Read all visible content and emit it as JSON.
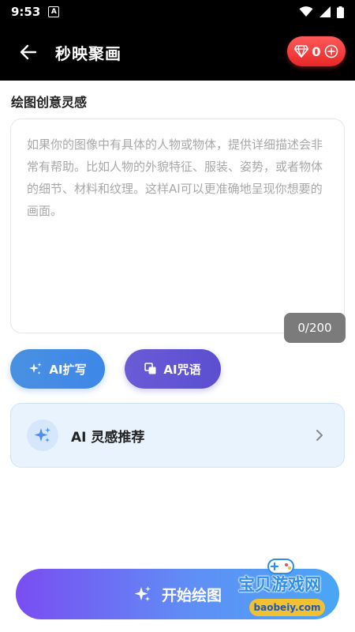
{
  "status_bar": {
    "time": "9:53",
    "notification_glyph": "A"
  },
  "header": {
    "title": "秒映聚画",
    "gem_count": "0"
  },
  "prompt": {
    "section_label": "绘图创意灵感",
    "placeholder": "如果你的图像中有具体的人物或物体，提供详细描述会非常有帮助。比如人物的外貌特征、服装、姿势，或者物体的细节、材料和纹理。这样AI可以更准确地呈现你想要的画面。",
    "value": "",
    "counter": "0/200"
  },
  "actions": {
    "expand_label": "AI扩写",
    "spell_label": "AI咒语"
  },
  "inspiration": {
    "label": "AI 灵感推荐"
  },
  "start_button": {
    "label": "开始绘图"
  },
  "watermark": {
    "brand": "宝贝游戏网",
    "domain": "baobeiy.com"
  },
  "colors": {
    "header_bg": "#000000",
    "gem_badge": "#e82727",
    "expand_btn": "#3d87e8",
    "spell_btn": "#5b4fd0",
    "card_bg": "#e9f3fe",
    "start_gradient_start": "#7a4df2",
    "start_gradient_end": "#4aa6f5"
  },
  "icons": {
    "back": "arrow-left-icon",
    "gem": "diamond-icon",
    "add": "plus-circle-icon",
    "sparkle": "sparkle-icon",
    "copy": "copy-icon",
    "chevron": "chevron-right-icon"
  }
}
